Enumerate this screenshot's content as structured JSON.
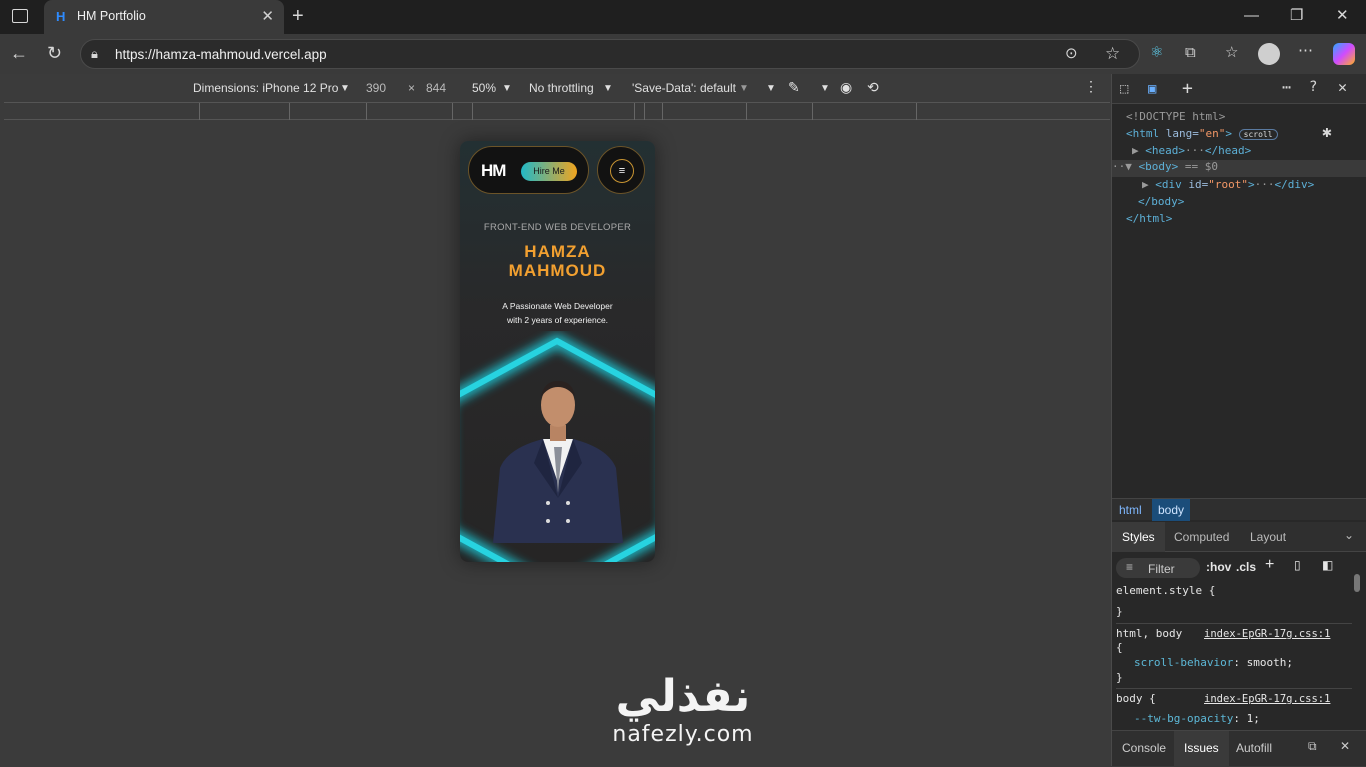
{
  "browser": {
    "tab_title": "HM Portfolio",
    "tab_favicon": "H",
    "url": "https://hamza-mahmoud.vercel.app"
  },
  "device_toolbar": {
    "dimensions": "Dimensions: iPhone 12 Pro",
    "width": "390",
    "height": "844",
    "zoom": "50%",
    "throttling": "No throttling",
    "save_data": "'Save-Data': default"
  },
  "site": {
    "logo": "HM",
    "hire_button": "Hire Me",
    "subtitle": "FRONT-END WEB DEVELOPER",
    "name_line1": "HAMZA",
    "name_line2": "MAHMOUD",
    "tagline_line1": "A Passionate Web Developer",
    "tagline_line2": "with 2 years of experience."
  },
  "devtools": {
    "doctype": "<!DOCTYPE html>",
    "html_open": "<html",
    "lang_attr": " lang=",
    "lang_val": "\"en\"",
    "close_gt": ">",
    "scroll_badge": "scroll",
    "head_line": "<head>",
    "head_close": "</head>",
    "body_open": "<body>",
    "body_eq": " == $0",
    "div_open": "<div",
    "div_attr": " id=",
    "div_val": "\"root\"",
    "div_close": "</div>",
    "body_close": "</body>",
    "html_close": "</html>",
    "crumb_html": "html",
    "crumb_body": "body",
    "tab_styles": "Styles",
    "tab_computed": "Computed",
    "tab_layout": "Layout",
    "filter_placeholder": "Filter",
    "hov": ":hov",
    "cls": ".cls",
    "rule1_selector": "element.style {",
    "rule1_close": "}",
    "rule2_selector": "html, body",
    "rule2_source": "index-EpGR-17g.css:1",
    "rule2_open": "{",
    "rule2_prop": "scroll-behavior",
    "rule2_value": "smooth;",
    "rule2_close": "}",
    "rule3_selector": "body {",
    "rule3_source": "index-EpGR-17g.css:1",
    "rule3_prop": "--tw-bg-opacity",
    "rule3_value": "1;",
    "bottom_console": "Console",
    "bottom_issues": "Issues",
    "bottom_autofill": "Autofill"
  },
  "watermark": {
    "arabic": "نفذلي",
    "latin": "nafezly.com"
  }
}
